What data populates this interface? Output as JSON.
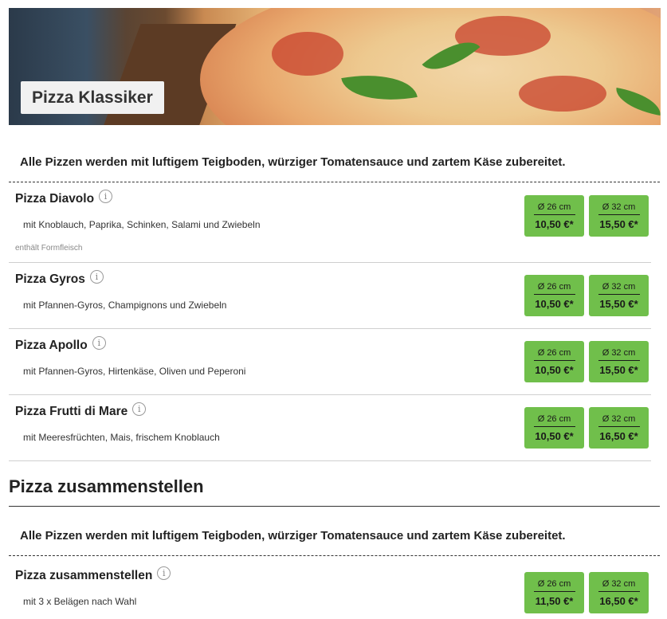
{
  "hero": {
    "title": "Pizza Klassiker"
  },
  "note": "Alle Pizzen werden mit luftigem Teigboden, würziger Tomatensauce und zartem Käse zubereitet.",
  "info_glyph": "i",
  "items": [
    {
      "name": "Pizza Diavolo",
      "desc": "mit Knoblauch, Paprika, Schinken, Salami und Zwiebeln",
      "extra": "enthält Formfleisch",
      "prices": [
        {
          "size": "Ø 26 cm",
          "price": "10,50 €*"
        },
        {
          "size": "Ø 32 cm",
          "price": "15,50 €*"
        }
      ]
    },
    {
      "name": "Pizza Gyros",
      "desc": "mit Pfannen-Gyros, Champignons und Zwiebeln",
      "prices": [
        {
          "size": "Ø 26 cm",
          "price": "10,50 €*"
        },
        {
          "size": "Ø 32 cm",
          "price": "15,50 €*"
        }
      ]
    },
    {
      "name": "Pizza Apollo",
      "desc": "mit Pfannen-Gyros, Hirtenkäse, Oliven und Peperoni",
      "prices": [
        {
          "size": "Ø 26 cm",
          "price": "10,50 €*"
        },
        {
          "size": "Ø 32 cm",
          "price": "15,50 €*"
        }
      ]
    },
    {
      "name": "Pizza Frutti di Mare",
      "desc": "mit Meeresfrüchten, Mais, frischem Knoblauch",
      "prices": [
        {
          "size": "Ø 26 cm",
          "price": "10,50 €*"
        },
        {
          "size": "Ø 32 cm",
          "price": "16,50 €*"
        }
      ]
    }
  ],
  "section2": {
    "title": "Pizza zusammenstellen",
    "note": "Alle Pizzen werden mit luftigem Teigboden, würziger Tomatensauce und zartem Käse zubereitet.",
    "item": {
      "name": "Pizza zusammenstellen",
      "desc": "mit 3 x Belägen nach Wahl",
      "prices": [
        {
          "size": "Ø 26 cm",
          "price": "11,50 €*"
        },
        {
          "size": "Ø 32 cm",
          "price": "16,50 €*"
        }
      ]
    }
  },
  "colors": {
    "price_button": "#70bf4b",
    "tag_bg": "#f1f1f1"
  }
}
